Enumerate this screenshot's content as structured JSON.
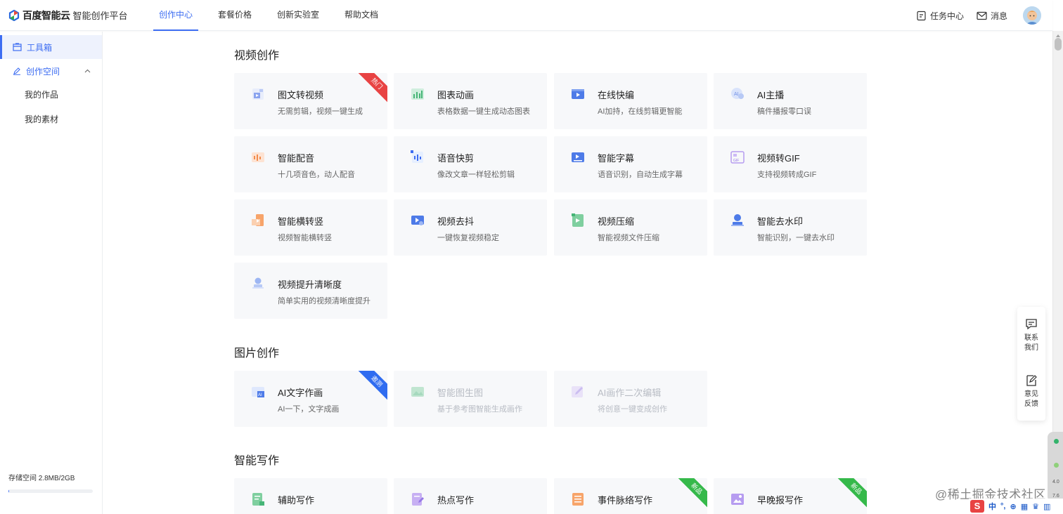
{
  "header": {
    "brand_name": "百度智能云",
    "brand_sub": "智能创作平台",
    "nav": [
      "创作中心",
      "套餐价格",
      "创新实验室",
      "帮助文档"
    ],
    "active_nav": "创作中心",
    "task_center": "任务中心",
    "messages": "消息"
  },
  "sidebar": {
    "toolbox": "工具箱",
    "creation_space": "创作空间",
    "sub_items": [
      "我的作品",
      "我的素材"
    ],
    "storage_label": "存储空间 2.8MB/2GB",
    "storage_used_fraction": 0.0014
  },
  "sections": {
    "video": {
      "title": "视频创作",
      "cards": [
        {
          "title": "图文转视频",
          "desc": "无需剪辑，视频一键生成",
          "badge": "热门",
          "icon": "image-video-icon"
        },
        {
          "title": "图表动画",
          "desc": "表格数据一键生成动态图表",
          "icon": "chart-animation-icon"
        },
        {
          "title": "在线快编",
          "desc": "AI加持，在线剪辑更智能",
          "icon": "online-edit-icon"
        },
        {
          "title": "AI主播",
          "desc": "稿件播报零口误",
          "icon": "ai-anchor-icon"
        },
        {
          "title": "智能配音",
          "desc": "十几项音色，动人配音",
          "icon": "voice-dub-icon"
        },
        {
          "title": "语音快剪",
          "desc": "像改文章一样轻松剪辑",
          "icon": "voice-cut-icon"
        },
        {
          "title": "智能字幕",
          "desc": "语音识别，自动生成字幕",
          "icon": "subtitle-icon"
        },
        {
          "title": "视频转GIF",
          "desc": "支持视频转成GIF",
          "icon": "gif-icon"
        },
        {
          "title": "智能横转竖",
          "desc": "视频智能横转竖",
          "icon": "rotate-video-icon"
        },
        {
          "title": "视频去抖",
          "desc": "一键恢复视频稳定",
          "icon": "stabilize-icon"
        },
        {
          "title": "视频压缩",
          "desc": "智能视频文件压缩",
          "icon": "compress-icon"
        },
        {
          "title": "智能去水印",
          "desc": "智能识别，一键去水印",
          "icon": "remove-watermark-icon"
        },
        {
          "title": "视频提升清晰度",
          "desc": "简单实用的视频清晰度提升",
          "icon": "enhance-icon"
        }
      ]
    },
    "image": {
      "title": "图片创作",
      "cards": [
        {
          "title": "AI文字作画",
          "desc": "AI一下，文字成画",
          "badge": "邀测",
          "icon": "ai-painting-icon"
        },
        {
          "title": "智能图生图",
          "desc": "基于参考图智能生成画作",
          "icon": "image-to-image-icon",
          "disabled": true
        },
        {
          "title": "AI画作二次编辑",
          "desc": "将创意一键变成创作",
          "icon": "edit-painting-icon",
          "disabled": true
        }
      ]
    },
    "writing": {
      "title": "智能写作",
      "cards": [
        {
          "title": "辅助写作",
          "desc": "",
          "icon": "assist-writing-icon"
        },
        {
          "title": "热点写作",
          "desc": "",
          "icon": "hot-writing-icon"
        },
        {
          "title": "事件脉络写作",
          "desc": "",
          "badge": "新品",
          "icon": "event-writing-icon"
        },
        {
          "title": "早晚报写作",
          "desc": "",
          "badge": "新品",
          "icon": "news-writing-icon"
        }
      ]
    }
  },
  "float_panel": {
    "contact": "联系我们",
    "feedback": "意见反馈"
  },
  "overlay": {
    "watermark": "@稀土掘金技术社区",
    "ime_logo": "S",
    "ime_items": [
      "中",
      "°,",
      "⊕",
      "▦",
      "♛",
      "▥"
    ],
    "edge_numbers": [
      "4.0",
      "7.6"
    ]
  },
  "colors": {
    "accent": "#3d6df2",
    "hot": "#e84343",
    "beta": "#2f6cf0",
    "new": "#35b94a",
    "card_bg": "#f7f8fa"
  }
}
